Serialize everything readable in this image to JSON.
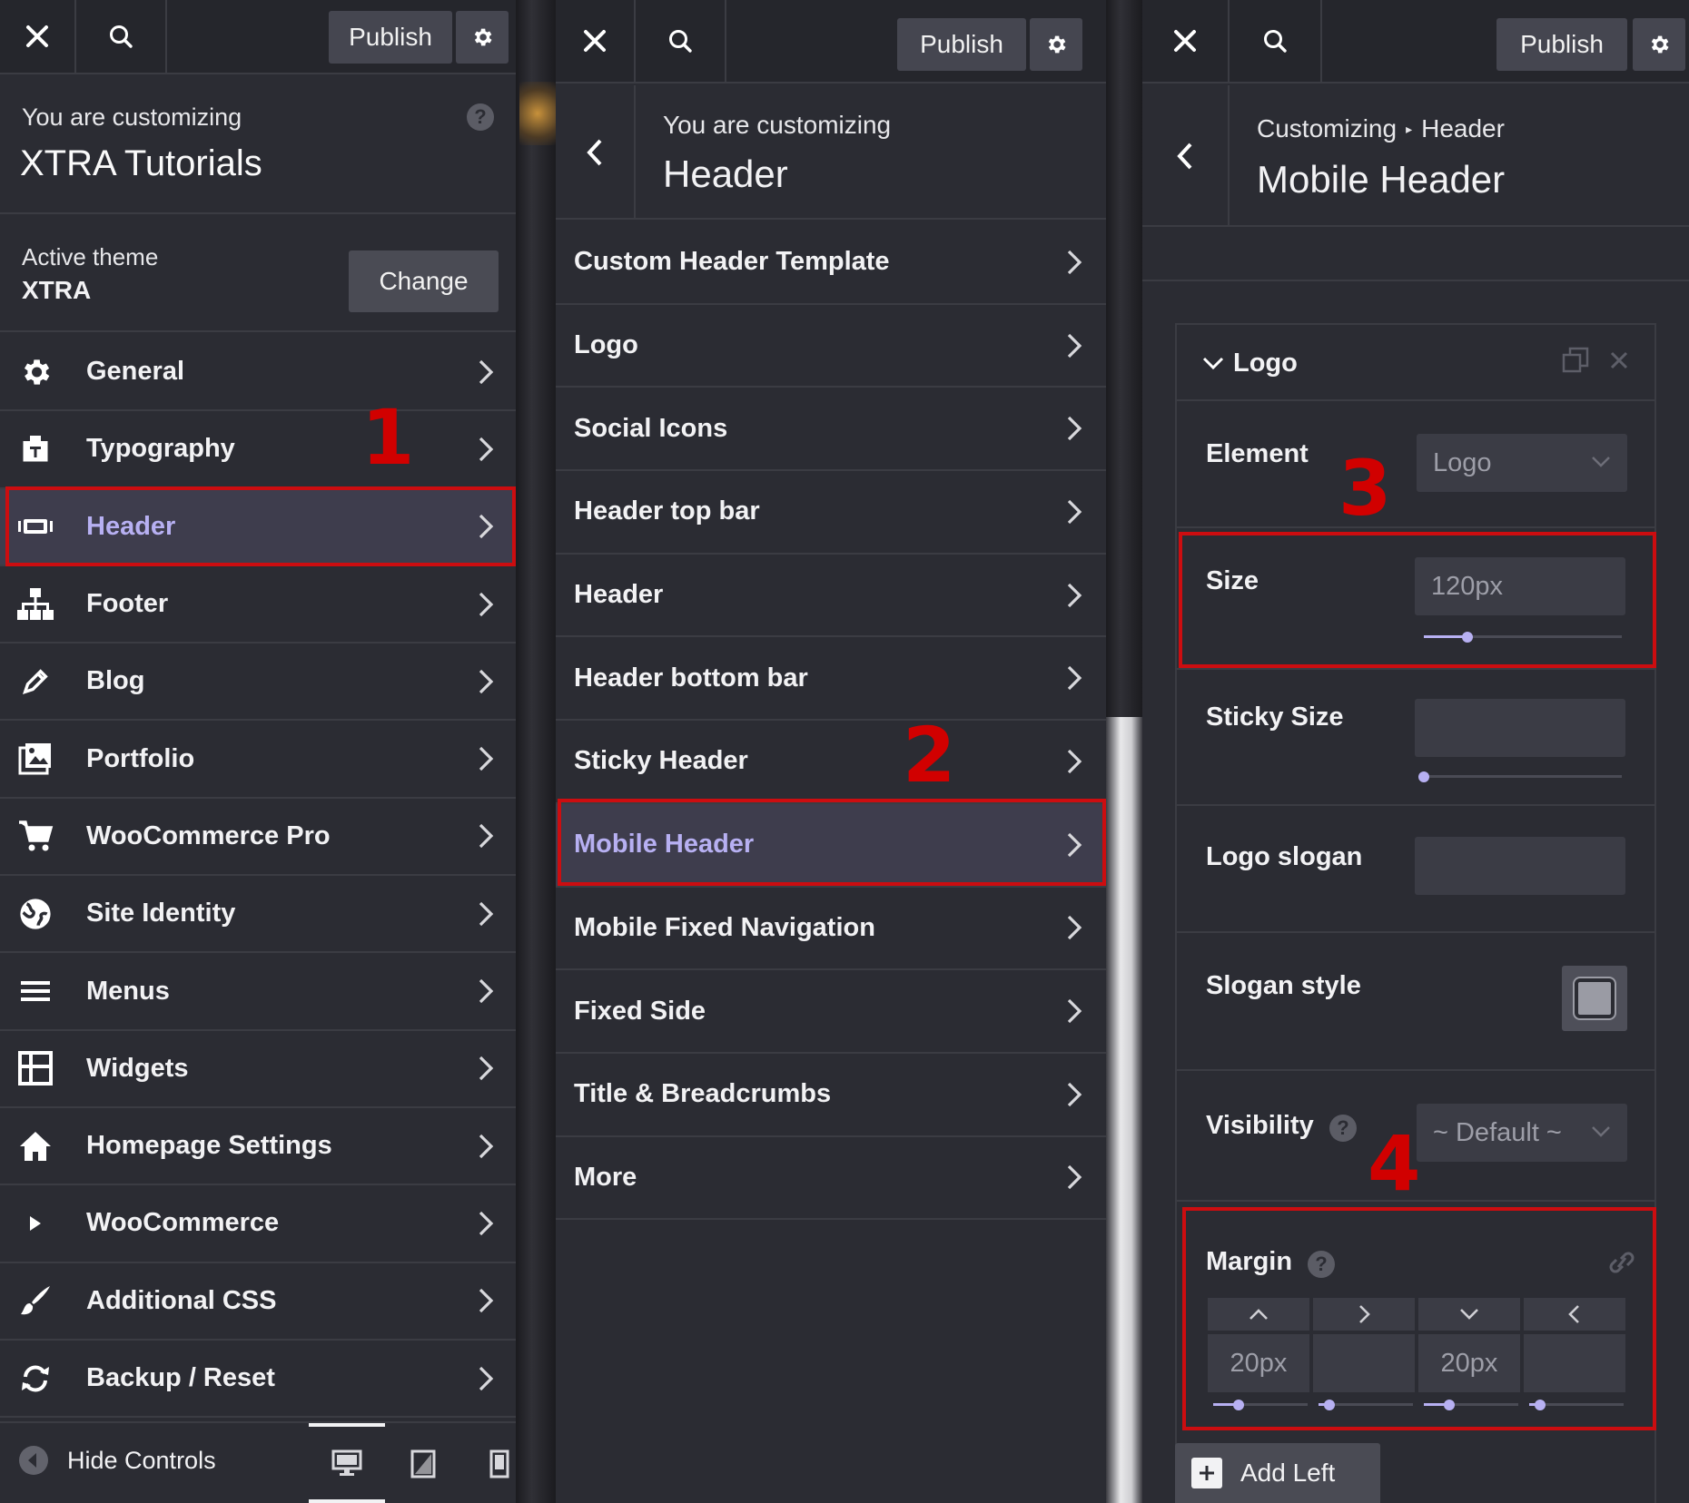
{
  "panel1": {
    "publish_label": "Publish",
    "customizing_sub": "You are customizing",
    "customizing_title": "XTRA Tutorials",
    "active_theme_label": "Active theme",
    "theme_name": "XTRA",
    "change_label": "Change",
    "items": [
      {
        "label": "General",
        "icon": "gear-icon"
      },
      {
        "label": "Typography",
        "icon": "typography-icon"
      },
      {
        "label": "Header",
        "icon": "header-icon"
      },
      {
        "label": "Footer",
        "icon": "sitemap-icon"
      },
      {
        "label": "Blog",
        "icon": "pencil-icon"
      },
      {
        "label": "Portfolio",
        "icon": "portfolio-icon"
      },
      {
        "label": "WooCommerce Pro",
        "icon": "cart-icon"
      },
      {
        "label": "Site Identity",
        "icon": "globe-icon"
      },
      {
        "label": "Menus",
        "icon": "menu-icon"
      },
      {
        "label": "Widgets",
        "icon": "widgets-icon"
      },
      {
        "label": "Homepage Settings",
        "icon": "home-icon"
      },
      {
        "label": "WooCommerce",
        "icon": "play-icon"
      },
      {
        "label": "Additional CSS",
        "icon": "brush-icon"
      },
      {
        "label": "Backup / Reset",
        "icon": "refresh-icon"
      }
    ],
    "hide_controls_label": "Hide Controls",
    "step_number": "1"
  },
  "panel2": {
    "publish_label": "Publish",
    "customizing_sub": "You are customizing",
    "customizing_title": "Header",
    "items": [
      {
        "label": "Custom Header Template"
      },
      {
        "label": "Logo"
      },
      {
        "label": "Social Icons"
      },
      {
        "label": "Header top bar"
      },
      {
        "label": "Header"
      },
      {
        "label": "Header bottom bar"
      },
      {
        "label": "Sticky Header"
      },
      {
        "label": "Mobile Header"
      },
      {
        "label": "Mobile Fixed Navigation"
      },
      {
        "label": "Fixed Side"
      },
      {
        "label": "Title & Breadcrumbs"
      },
      {
        "label": "More"
      }
    ],
    "step_number": "2"
  },
  "panel3": {
    "publish_label": "Publish",
    "breadcrumb_root": "Customizing",
    "breadcrumb_leaf": "Header",
    "title": "Mobile Header",
    "card_title": "Logo",
    "element_label": "Element",
    "element_value": "Logo",
    "size_label": "Size",
    "size_value": "120px",
    "size_level": 0.22,
    "sticky_size_label": "Sticky Size",
    "logo_slogan_label": "Logo slogan",
    "slogan_style_label": "Slogan style",
    "visibility_label": "Visibility",
    "visibility_value": "~ Default ~",
    "margin_label": "Margin",
    "margin_values": [
      "20px",
      "",
      "20px",
      ""
    ],
    "add_left_label": "Add Left",
    "step3": "3",
    "step4": "4"
  },
  "colors": {
    "panel_bg": "#2b2c33",
    "accent": "#b7b0f2",
    "highlight_border": "#cc0d10",
    "step_number": "#d10000"
  }
}
